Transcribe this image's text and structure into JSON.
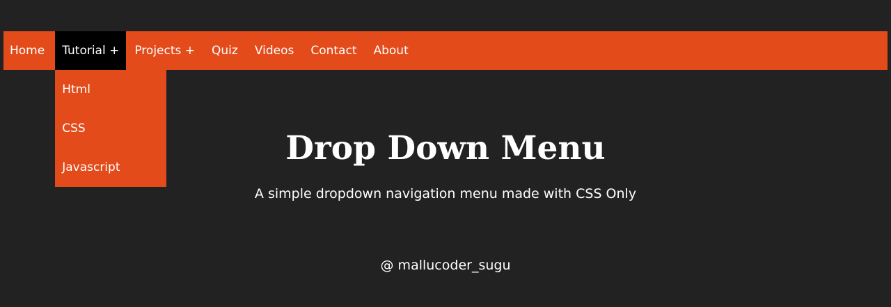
{
  "nav": {
    "items": [
      {
        "label": "Home"
      },
      {
        "label": "Tutorial +"
      },
      {
        "label": "Projects +"
      },
      {
        "label": "Quiz"
      },
      {
        "label": "Videos"
      },
      {
        "label": "Contact"
      },
      {
        "label": "About"
      }
    ],
    "dropdown": [
      {
        "label": "Html"
      },
      {
        "label": "CSS"
      },
      {
        "label": "Javascript"
      }
    ]
  },
  "hero": {
    "title": "Drop Down Menu",
    "subtitle": "A simple dropdown navigation menu made with CSS Only"
  },
  "footer": {
    "credit": "@ mallucoder_sugu"
  },
  "colors": {
    "background": "#222222",
    "accent": "#e44b1a",
    "active_item": "#000000",
    "text": "#ffffff"
  }
}
